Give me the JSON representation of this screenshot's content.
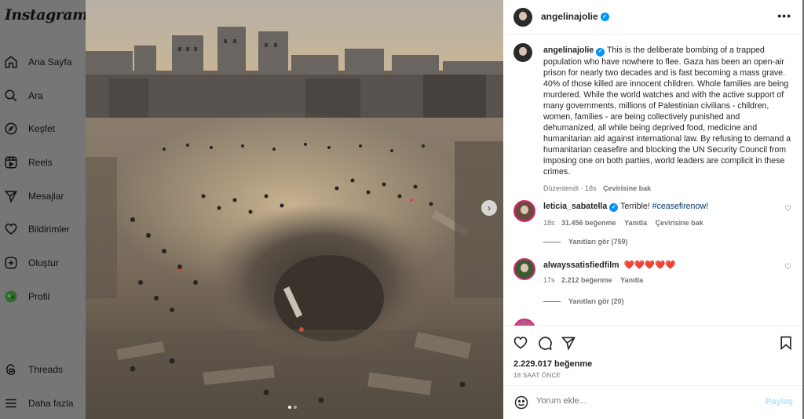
{
  "app": {
    "logo": "Instagram"
  },
  "sidebar": {
    "items": [
      {
        "label": "Ana Sayfa",
        "icon": "home-icon"
      },
      {
        "label": "Ara",
        "icon": "search-icon"
      },
      {
        "label": "Keşfet",
        "icon": "compass-icon"
      },
      {
        "label": "Reels",
        "icon": "reels-icon"
      },
      {
        "label": "Mesajlar",
        "icon": "send-icon"
      },
      {
        "label": "Bildirimler",
        "icon": "heart-icon"
      },
      {
        "label": "Oluştur",
        "icon": "plus-square-icon"
      },
      {
        "label": "Profil",
        "icon": "profile-avatar"
      }
    ],
    "bottom": [
      {
        "label": "Threads",
        "icon": "threads-icon"
      },
      {
        "label": "Daha fazla",
        "icon": "menu-icon"
      }
    ]
  },
  "post": {
    "author": "angelinajolie",
    "more_icon": "more-horizontal-icon",
    "caption": "This is the deliberate bombing of a trapped population who have nowhere to flee. Gaza has been an open-air prison for nearly two decades and is fast becoming a mass grave. 40% of those killed are innocent children. Whole families are being murdered. While the world watches and with the active support of many governments, millions of Palestinian civilians - children, women, families - are being collectively punished and dehumanized, all while being deprived food, medicine and humanitarian aid against international law. By refusing to demand a humanitarian ceasefire and blocking the UN Security Council from imposing one on both parties, world leaders are complicit in these crimes.",
    "caption_meta": {
      "edited": "Düzenlendi",
      "age": "18s",
      "translate": "Çevirisine bak"
    }
  },
  "comments": [
    {
      "user": "leticia_sabatella",
      "verified": true,
      "text": "Terrible! ",
      "hashtag": "#ceasefirenow!",
      "age": "18s",
      "likes": "31.456 beğenme",
      "reply": "Yanıtla",
      "translate": "Çevirisine bak",
      "view_replies": "Yanıtları gör (759)"
    },
    {
      "user": "alwayssatisfiedfilm",
      "verified": false,
      "text": "❤️❤️❤️❤️❤️",
      "age": "17s",
      "likes": "2.212 beğenme",
      "reply": "Yanıtla",
      "view_replies": "Yanıtları gör (20)"
    }
  ],
  "footer": {
    "likes": "2.229.017 beğenme",
    "time": "18 SAAT ÖNCE",
    "comment_placeholder": "Yorum ekle...",
    "post_label": "Paylaş"
  },
  "colors": {
    "verified": "#0095f6",
    "hashtag": "#00376b",
    "post_disabled": "#b2dffc"
  }
}
